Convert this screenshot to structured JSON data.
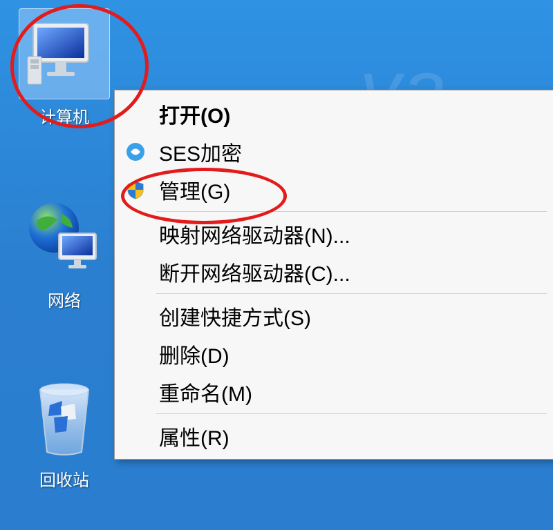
{
  "desktop": {
    "icons": [
      {
        "label": "计算机"
      },
      {
        "label": "网络"
      },
      {
        "label": "回收站"
      }
    ]
  },
  "context_menu": {
    "sections": [
      [
        {
          "label": "打开(O)",
          "bold": true,
          "icon": null
        },
        {
          "label": "SES加密",
          "bold": false,
          "icon": "ses"
        },
        {
          "label": "管理(G)",
          "bold": false,
          "icon": "shield"
        }
      ],
      [
        {
          "label": "映射网络驱动器(N)...",
          "bold": false,
          "icon": null
        },
        {
          "label": "断开网络驱动器(C)...",
          "bold": false,
          "icon": null
        }
      ],
      [
        {
          "label": "创建快捷方式(S)",
          "bold": false,
          "icon": null
        },
        {
          "label": "删除(D)",
          "bold": false,
          "icon": null
        },
        {
          "label": "重命名(M)",
          "bold": false,
          "icon": null
        }
      ],
      [
        {
          "label": "属性(R)",
          "bold": false,
          "icon": null
        }
      ]
    ]
  },
  "watermark": "ya"
}
